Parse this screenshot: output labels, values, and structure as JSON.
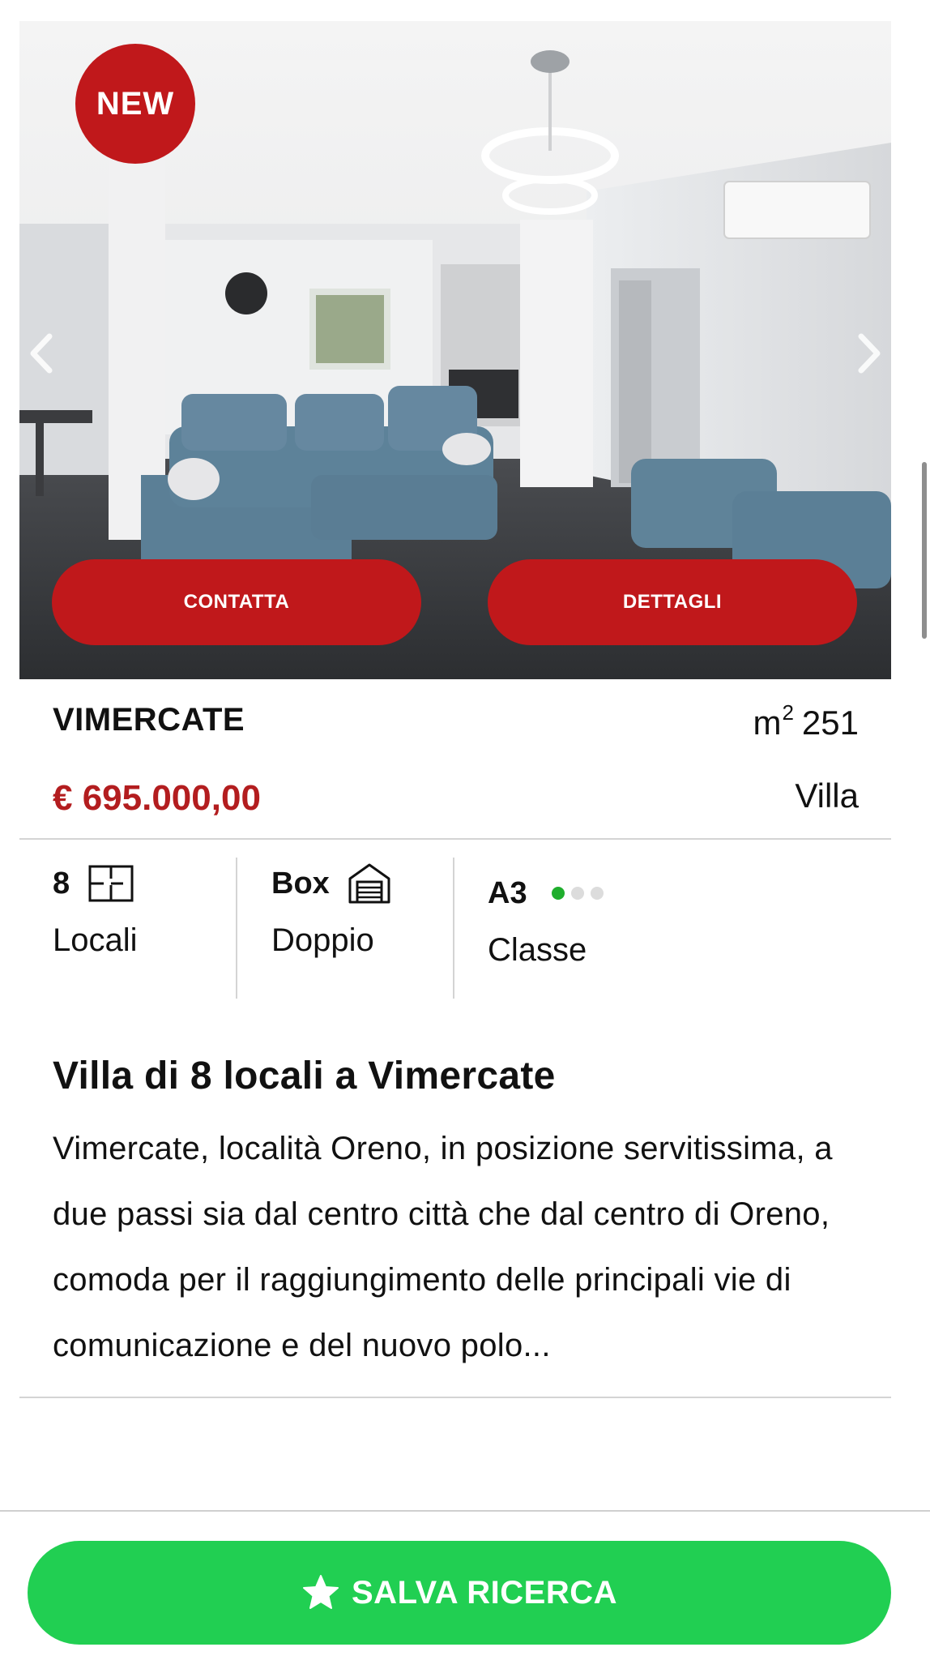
{
  "listing": {
    "badge": "NEW",
    "buttons": {
      "contact": "CONTATTA",
      "details": "DETTAGLI"
    },
    "city": "VIMERCATE",
    "area_unit": "m",
    "area_exp": "2",
    "area_value": "251",
    "price": "€ 695.000,00",
    "property_type": "Villa",
    "features": [
      {
        "value": "8",
        "label": "Locali",
        "icon": "floorplan-icon"
      },
      {
        "value": "Box",
        "label": "Doppio",
        "icon": "garage-icon"
      },
      {
        "value": "A3",
        "label": "Classe",
        "icon": "energy-dots",
        "dots_active": 1,
        "dots_total": 3
      }
    ],
    "title": "Villa di 8 locali a Vimercate",
    "description": "Vimercate, località Oreno, in posizione servitissima, a due passi sia dal centro città che dal centro di Oreno, comoda per il raggiungimento delle principali vie di comunicazione e del nuovo polo..."
  },
  "bottom_bar": {
    "save_label": "SALVA RICERCA",
    "icon": "star-icon"
  },
  "colors": {
    "brand_red": "#c0181b",
    "price_red": "#b31d1f",
    "save_green": "#21cf52",
    "energy_green": "#1fae2d"
  }
}
